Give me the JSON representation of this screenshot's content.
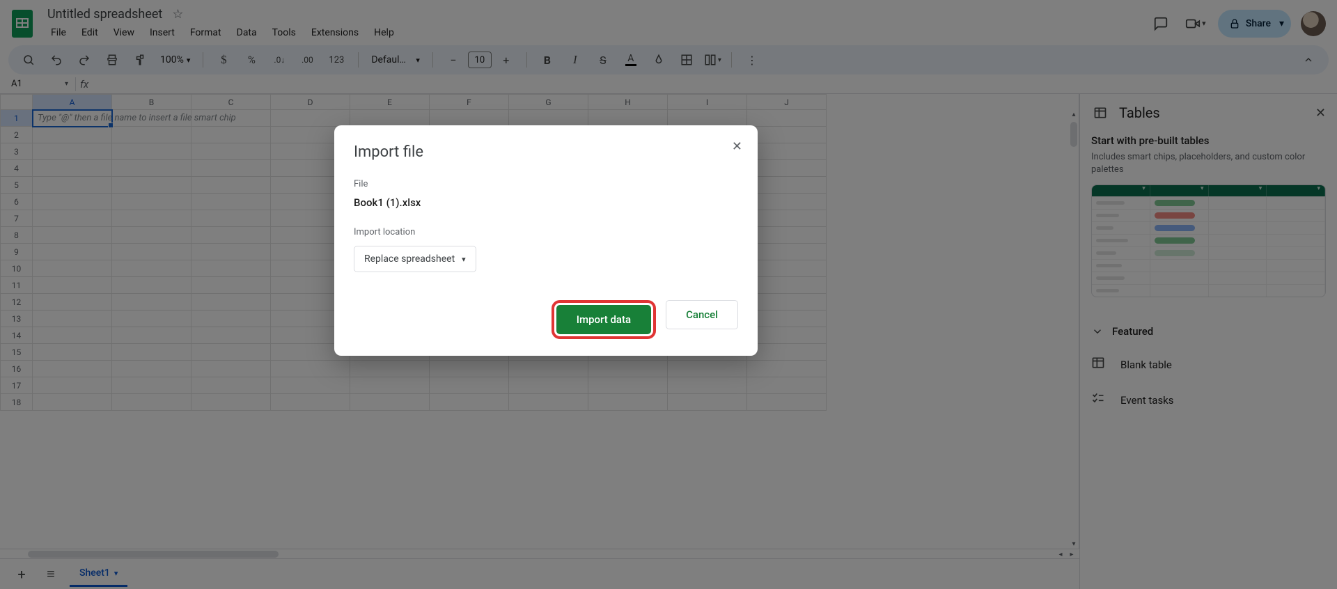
{
  "doc": {
    "title": "Untitled spreadsheet"
  },
  "menu": {
    "file": "File",
    "edit": "Edit",
    "view": "View",
    "insert": "Insert",
    "format": "Format",
    "data": "Data",
    "tools": "Tools",
    "extensions": "Extensions",
    "help": "Help"
  },
  "share": {
    "label": "Share"
  },
  "toolbar": {
    "zoom": "100%",
    "font": "Defaul…",
    "font_size": "10",
    "fmt_123": "123"
  },
  "namebox": {
    "ref": "A1"
  },
  "grid": {
    "cols": [
      "A",
      "B",
      "C",
      "D",
      "E",
      "F",
      "G",
      "H",
      "I",
      "J"
    ],
    "rows": [
      1,
      2,
      3,
      4,
      5,
      6,
      7,
      8,
      9,
      10,
      11,
      12,
      13,
      14,
      15,
      16,
      17,
      18
    ],
    "a1_placeholder": "Type \"@\" then a file name to insert a file smart chip"
  },
  "sheet": {
    "active_name": "Sheet1"
  },
  "sidebar": {
    "title": "Tables",
    "sub_title": "Start with pre-built tables",
    "sub_desc": "Includes smart chips, placeholders, and custom color palettes",
    "featured": "Featured",
    "items": {
      "blank": "Blank table",
      "events": "Event tasks"
    }
  },
  "dialog": {
    "title": "Import file",
    "file_label": "File",
    "file_name": "Book1 (1).xlsx",
    "loc_label": "Import location",
    "loc_value": "Replace spreadsheet",
    "primary": "Import data",
    "secondary": "Cancel"
  }
}
